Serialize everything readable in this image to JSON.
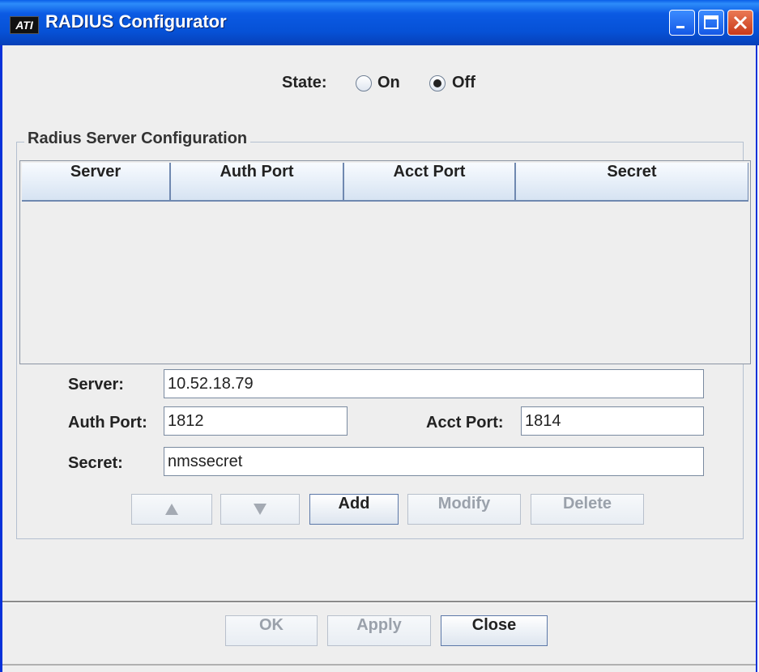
{
  "window": {
    "title": "RADIUS Configurator",
    "app_icon_text": "ATI"
  },
  "state": {
    "label": "State:",
    "options": [
      {
        "label": "On",
        "selected": false
      },
      {
        "label": "Off",
        "selected": true
      }
    ]
  },
  "group": {
    "title": "Radius Server Configuration"
  },
  "table": {
    "columns": [
      "Server",
      "Auth Port",
      "Acct Port",
      "Secret"
    ],
    "rows": []
  },
  "form": {
    "server_label": "Server:",
    "server_value": "10.52.18.79",
    "auth_port_label": "Auth Port:",
    "auth_port_value": "1812",
    "acct_port_label": "Acct Port:",
    "acct_port_value": "1814",
    "secret_label": "Secret:",
    "secret_value": "nmssecret"
  },
  "actions": {
    "up_icon": "arrow-up-icon",
    "down_icon": "arrow-down-icon",
    "add": "Add",
    "modify": "Modify",
    "delete": "Delete"
  },
  "footer": {
    "ok": "OK",
    "apply": "Apply",
    "close": "Close"
  },
  "colors": {
    "titlebar": "#0651d6",
    "close_button": "#c8391a",
    "window_bg": "#eeeeee"
  }
}
